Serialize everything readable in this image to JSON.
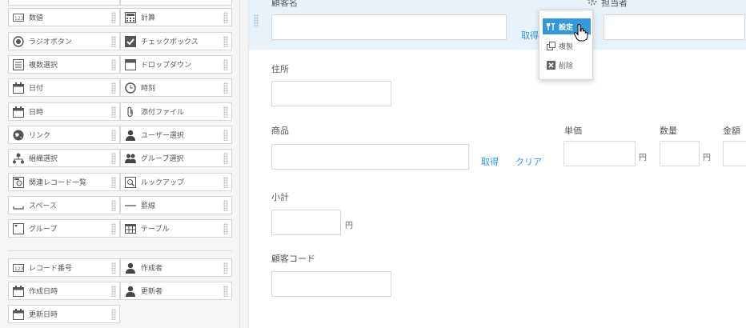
{
  "palette": {
    "items": [
      {
        "label": "数値",
        "icon": "number-icon"
      },
      {
        "label": "計算",
        "icon": "calculator-icon"
      },
      {
        "label": "ラジオボタン",
        "icon": "radio-icon"
      },
      {
        "label": "チェックボックス",
        "icon": "checkbox-icon"
      },
      {
        "label": "複数選択",
        "icon": "list-icon"
      },
      {
        "label": "ドロップダウン",
        "icon": "dropdown-icon"
      },
      {
        "label": "日付",
        "icon": "calendar-icon"
      },
      {
        "label": "時刻",
        "icon": "clock-icon"
      },
      {
        "label": "日時",
        "icon": "calendar-icon"
      },
      {
        "label": "添付ファイル",
        "icon": "paperclip-icon"
      },
      {
        "label": "リンク",
        "icon": "globe-icon"
      },
      {
        "label": "ユーザー選択",
        "icon": "user-icon"
      },
      {
        "label": "組織選択",
        "icon": "org-icon"
      },
      {
        "label": "グループ選択",
        "icon": "group-icon"
      },
      {
        "label": "関連レコード一覧",
        "icon": "related-records-icon"
      },
      {
        "label": "ルックアップ",
        "icon": "lookup-icon"
      },
      {
        "label": "スペース",
        "icon": "space-icon"
      },
      {
        "label": "罫線",
        "icon": "line-icon"
      },
      {
        "label": "グループ",
        "icon": "group-box-icon"
      },
      {
        "label": "テーブル",
        "icon": "table-icon"
      }
    ],
    "system_items": [
      {
        "label": "レコード番号",
        "icon": "number-icon"
      },
      {
        "label": "作成者",
        "icon": "user-icon"
      },
      {
        "label": "作成日時",
        "icon": "calendar-icon"
      },
      {
        "label": "更新者",
        "icon": "user-icon"
      },
      {
        "label": "更新日時",
        "icon": "calendar-icon"
      }
    ]
  },
  "form": {
    "customer_name_label": "顧客名",
    "get_link": "取得",
    "owner_label": "担当者",
    "address_label": "住所",
    "product_label": "商品",
    "product_get_link": "取得",
    "product_clear_link": "クリア",
    "unit_price_label": "単価",
    "quantity_label": "数量",
    "amount_label": "金額",
    "yen": "円",
    "subtotal_label": "小計",
    "customer_code_label": "顧客コード"
  },
  "popup": {
    "settings": "設定",
    "duplicate": "複製",
    "delete": "削除"
  },
  "colors": {
    "accent": "#3498db",
    "selected_row": "#e8f2fb"
  }
}
